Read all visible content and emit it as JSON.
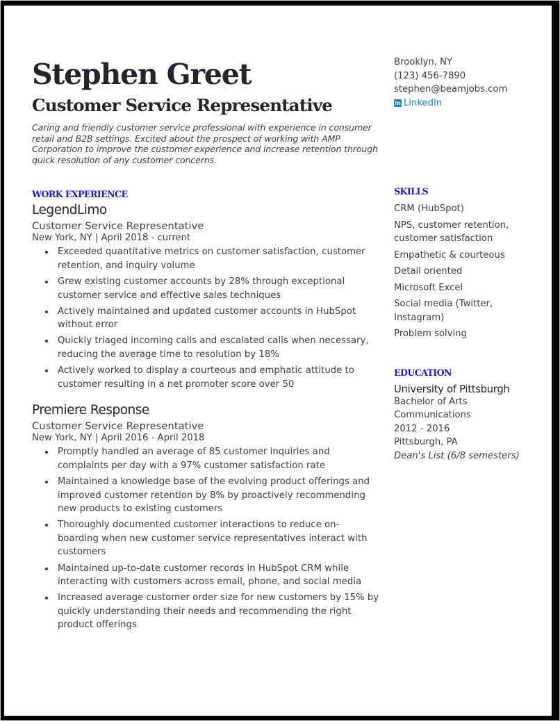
{
  "header": {
    "name": "Stephen Greet",
    "title": "Customer Service Representative",
    "summary": "Caring and friendly customer service professional with experience in consumer retail and B2B settings. Excited about the prospect of working with AMP Corporation to improve the customer experience and increase retention through quick resolution of any customer concerns."
  },
  "contact": {
    "location": "Brooklyn, NY",
    "phone": "(123) 456-7890",
    "email": "stephen@beamjobs.com",
    "linkedin_label": "LinkedIn",
    "linkedin_icon": "linkedin-icon"
  },
  "work_experience": {
    "heading": "WORK EXPERIENCE",
    "jobs": [
      {
        "company": "LegendLimo",
        "role": "Customer Service Representative",
        "meta": "New York, NY | April 2018 - current",
        "bullets": [
          "Exceeded quantitative metrics on customer satisfaction, customer retention, and inquiry volume",
          "Grew existing customer accounts by 28% through exceptional customer service and effective sales techniques",
          "Actively maintained and updated customer accounts in HubSpot without error",
          "Quickly triaged incoming calls and escalated calls when necessary, reducing the average time to resolution by 18%",
          "Actively worked to display a courteous and emphatic attitude to customer resulting in a net promoter score over 50"
        ]
      },
      {
        "company": "Premiere Response",
        "role": "Customer Service Representative",
        "meta": "New York, NY | April 2016 - April 2018",
        "bullets": [
          "Promptly handled an average of 85 customer inquiries and complaints per day with a 97% customer satisfaction rate",
          "Maintained a knowledge base of the evolving product offerings and improved customer retention by 8% by proactively recommending new products to existing customers",
          "Thoroughly documented customer interactions to reduce on-boarding when new customer service representatives interact with customers",
          "Maintained up-to-date customer records in HubSpot CRM while interacting with customers across email, phone, and social media",
          "Increased average customer order size for new customers by 15% by quickly understanding their needs and recommending the right product offerings"
        ]
      }
    ]
  },
  "skills": {
    "heading": "SKILLS",
    "items": [
      "CRM (HubSpot)",
      "NPS, customer retention, customer satisfaction",
      "Empathetic & courteous",
      "Detail oriented",
      "Microsoft Excel",
      "Social media (Twitter, Instagram)",
      "Problem solving"
    ]
  },
  "education": {
    "heading": "EDUCATION",
    "school": "University of Pittsburgh",
    "degree": "Bachelor of Arts",
    "field": "Communications",
    "years": "2012 - 2016",
    "location": "Pittsburgh, PA",
    "honors": "Dean's List (6/8 semesters)"
  },
  "colors": {
    "accent": "#1a1acd",
    "link": "#1e7fd6",
    "text": "#3a3d42",
    "heading_text": "#22252b",
    "frame": "#000000"
  }
}
